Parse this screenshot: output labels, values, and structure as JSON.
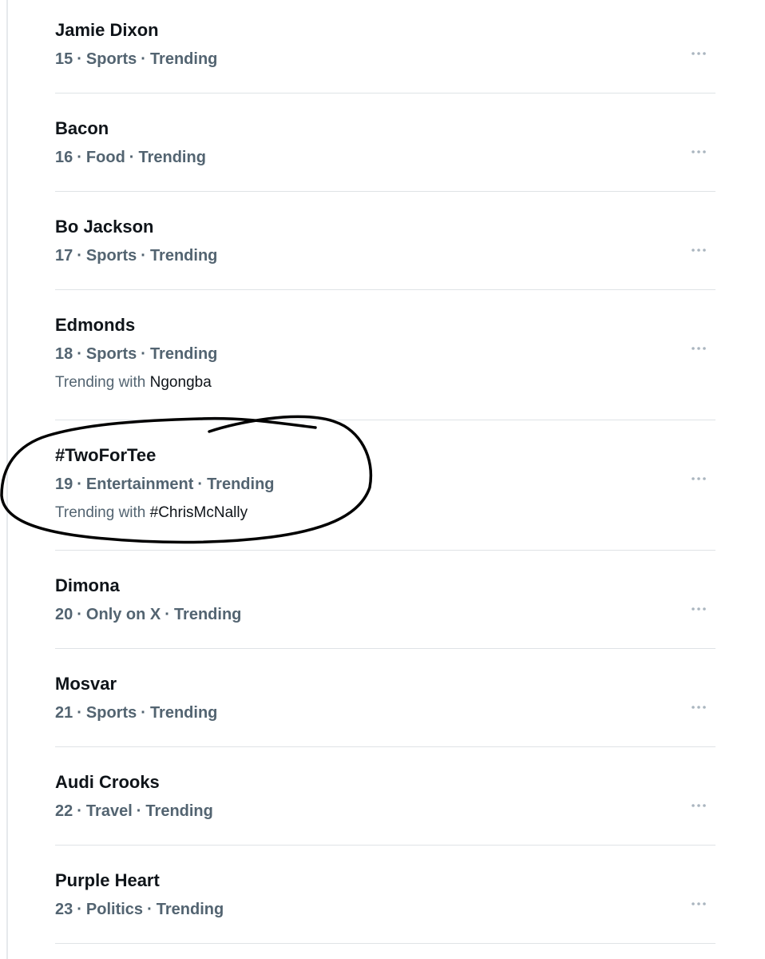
{
  "trends": [
    {
      "name": "Jamie Dixon",
      "rank": "15",
      "category": "Sports",
      "status": "Trending",
      "with_label": "",
      "with_target": ""
    },
    {
      "name": "Bacon",
      "rank": "16",
      "category": "Food",
      "status": "Trending",
      "with_label": "",
      "with_target": ""
    },
    {
      "name": "Bo Jackson",
      "rank": "17",
      "category": "Sports",
      "status": "Trending",
      "with_label": "",
      "with_target": ""
    },
    {
      "name": "Edmonds",
      "rank": "18",
      "category": "Sports",
      "status": "Trending",
      "with_label": "Trending with",
      "with_target": "Ngongba"
    },
    {
      "name": "#TwoForTee",
      "rank": "19",
      "category": "Entertainment",
      "status": "Trending",
      "with_label": "Trending with",
      "with_target": "#ChrisMcNally"
    },
    {
      "name": "Dimona",
      "rank": "20",
      "category": "Only on X",
      "status": "Trending",
      "with_label": "",
      "with_target": ""
    },
    {
      "name": "Mosvar",
      "rank": "21",
      "category": "Sports",
      "status": "Trending",
      "with_label": "",
      "with_target": ""
    },
    {
      "name": "Audi Crooks",
      "rank": "22",
      "category": "Travel",
      "status": "Trending",
      "with_label": "",
      "with_target": ""
    },
    {
      "name": "Purple Heart",
      "rank": "23",
      "category": "Politics",
      "status": "Trending",
      "with_label": "",
      "with_target": ""
    }
  ],
  "meta_separator": "·",
  "more_icon": "more-horizontal-icon",
  "colors": {
    "primary_text": "#0f1419",
    "secondary_text": "#536471",
    "divider": "#dfe3e6",
    "more_icon": "#aab5bf",
    "annotation_ink": "#000000"
  },
  "annotation": {
    "kind": "hand-drawn circle",
    "circled_trend": "#TwoForTee"
  }
}
